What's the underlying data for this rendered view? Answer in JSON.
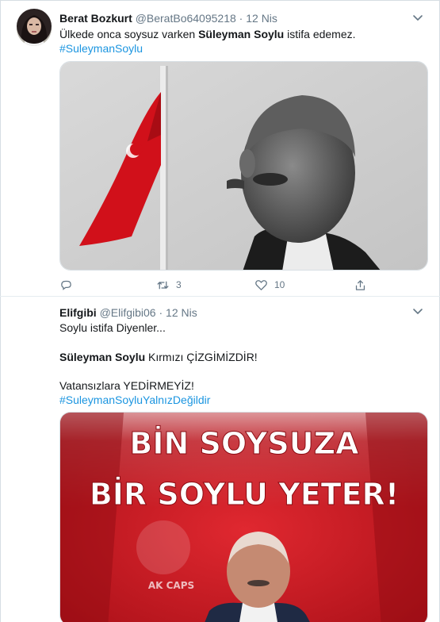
{
  "tweets": [
    {
      "name": "Berat Bozkurt",
      "handle": "@BeratBo64095218",
      "separator": "·",
      "date": "12 Nis",
      "text_line1_prefix": "Ülkede onca soysuz varken ",
      "text_line1_bold": "Süleyman Soylu",
      "text_line1_suffix": " istifa edemez.",
      "hashtag": "#SuleymanSoylu",
      "retweets": "3",
      "likes": "10"
    },
    {
      "name": "Elifgibi",
      "handle": "@Elifgibi06",
      "separator": "·",
      "date": "12 Nis",
      "line1": "Soylu istifa Diyenler...",
      "line2_bold": "Süleyman Soylu",
      "line2_suffix": " Kırmızı ÇİZGİMİZDİR!",
      "line3": "Vatansızlara YEDİRMEYİZ!",
      "hashtag": "#SuleymanSoyluYalnızDeğildir",
      "poster_line1": "BİN SOYSUZA",
      "poster_line2": "BİR SOYLU YETER!",
      "watermark": "AK CAPS"
    }
  ],
  "colors": {
    "link": "#1b95e0",
    "secondary": "#657786",
    "poster_red": "#c8141f"
  }
}
